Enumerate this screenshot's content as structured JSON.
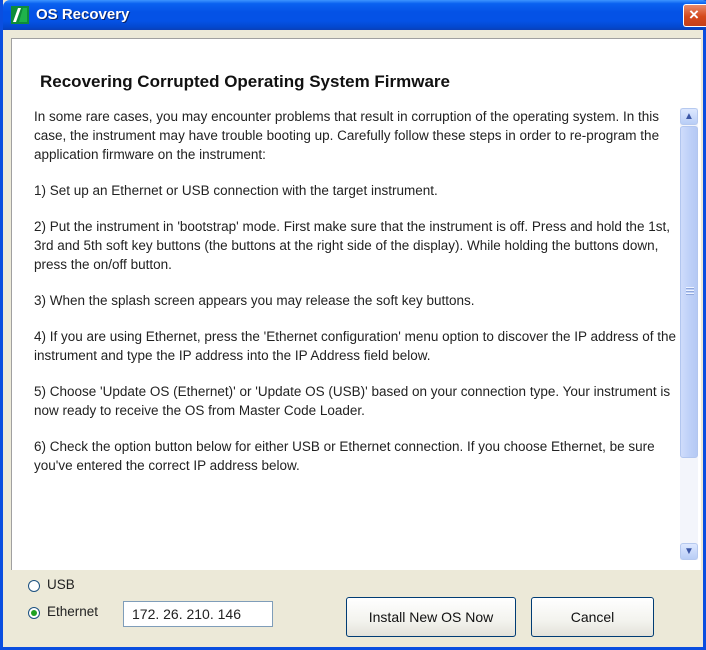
{
  "window": {
    "title": "OS Recovery",
    "close_label": "×"
  },
  "content": {
    "heading": "Recovering Corrupted Operating System Firmware",
    "paragraphs": [
      "In some rare cases, you may encounter problems that result in corruption of the operating system. In this case, the instrument may have trouble booting up. Carefully follow these steps in order to re-program the application firmware on the instrument:",
      "1) Set up an Ethernet or USB connection with the target instrument.",
      "2) Put the instrument in 'bootstrap' mode. First make sure that the instrument is off. Press and hold the 1st, 3rd and 5th soft key buttons (the buttons at the right side of the display). While holding the buttons down, press the on/off button.",
      "3) When the splash screen appears you may release the soft key buttons.",
      "4) If you are using Ethernet, press the 'Ethernet configuration' menu option to discover the IP address of the instrument and type the IP address into the IP Address field below.",
      "5) Choose 'Update OS (Ethernet)' or 'Update OS (USB)' based on your connection type. Your instrument is now ready to receive the OS from Master Code Loader.",
      "6) Check the option button below for either USB or Ethernet connection. If you choose Ethernet, be sure you've entered the correct IP address below."
    ]
  },
  "scrollbar": {
    "up_icon": "▲",
    "down_icon": "▼"
  },
  "connection": {
    "options": [
      {
        "label": "USB",
        "selected": false
      },
      {
        "label": "Ethernet",
        "selected": true
      }
    ],
    "ip_address": "172. 26. 210. 146"
  },
  "buttons": {
    "install": "Install New OS Now",
    "cancel": "Cancel"
  }
}
